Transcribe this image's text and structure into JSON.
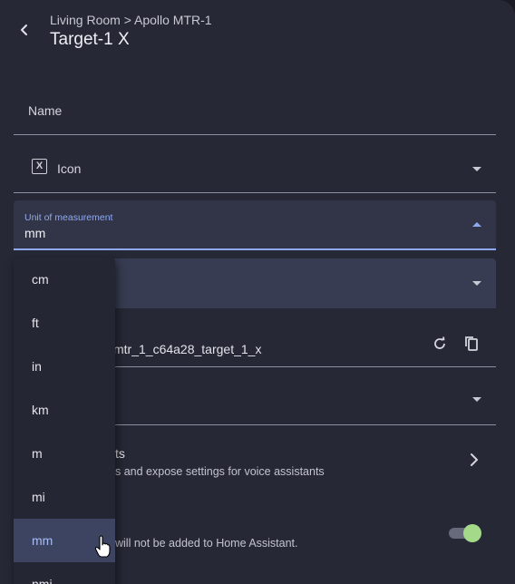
{
  "header": {
    "breadcrumb": "Living Room > Apollo MTR-1",
    "title": "Target-1 X"
  },
  "form": {
    "name_label": "Name",
    "icon_label": "Icon",
    "icon_glyph": "X",
    "unit": {
      "label": "Unit of measurement",
      "value": "mm"
    },
    "entity_id_partial": "mtr_1_c64a28_target_1_x"
  },
  "voice": {
    "title_partial": "ts",
    "subtitle_partial": "s and expose settings for voice assistants"
  },
  "enable": {
    "subtitle_partial": "will not be added to Home Assistant.",
    "enabled": true
  },
  "menu": {
    "items": [
      {
        "label": "cm"
      },
      {
        "label": "ft"
      },
      {
        "label": "in"
      },
      {
        "label": "km"
      },
      {
        "label": "m"
      },
      {
        "label": "mi"
      },
      {
        "label": "mm"
      },
      {
        "label": "nmi"
      }
    ],
    "selected": "mm"
  },
  "colors": {
    "accent": "#8ea9f0",
    "toggle_on": "#a5d98a",
    "surface": "#262836"
  },
  "icons": [
    "back-arrow-icon",
    "caret-down-icon",
    "caret-up-icon",
    "reset-icon",
    "copy-icon",
    "chevron-right-icon",
    "hand-pointer-icon"
  ]
}
